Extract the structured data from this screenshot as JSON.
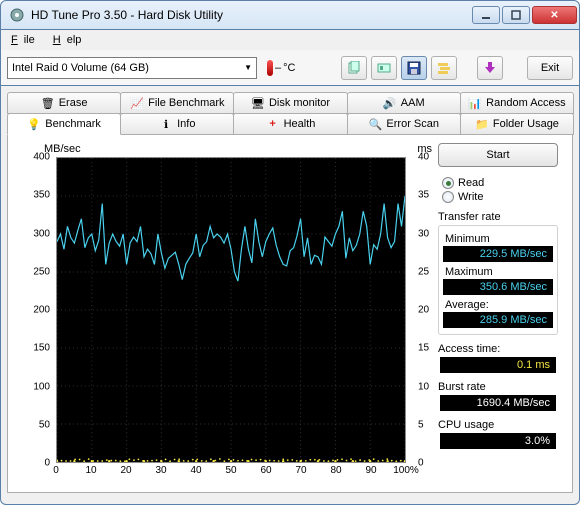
{
  "titlebar": {
    "title": "HD Tune Pro 3.50 - Hard Disk Utility"
  },
  "menu": {
    "file": "File",
    "help": "Help"
  },
  "toolbar": {
    "disk": "Intel   Raid 0 Volume (64 GB)",
    "temp": "°C",
    "exit": "Exit"
  },
  "tabs_row1": [
    "Erase",
    "File Benchmark",
    "Disk monitor",
    "AAM",
    "Random Access"
  ],
  "tabs_row2": [
    "Benchmark",
    "Info",
    "Health",
    "Error Scan",
    "Folder Usage"
  ],
  "side": {
    "start": "Start",
    "read": "Read",
    "write": "Write",
    "transfer": "Transfer rate",
    "min_l": "Minimum",
    "min_v": "229.5 MB/sec",
    "max_l": "Maximum",
    "max_v": "350.6 MB/sec",
    "avg_l": "Average:",
    "avg_v": "285.9 MB/sec",
    "access_l": "Access time:",
    "access_v": "0.1 ms",
    "burst_l": "Burst rate",
    "burst_v": "1690.4 MB/sec",
    "cpu_l": "CPU usage",
    "cpu_v": "3.0%"
  },
  "chart_data": {
    "type": "line",
    "title": "",
    "xlabel": "",
    "ylabel": "MB/sec",
    "y2label": "ms",
    "xlim": [
      0,
      100
    ],
    "ylim": [
      0,
      400
    ],
    "y2lim": [
      0,
      40
    ],
    "x_ticks": [
      "0",
      "10",
      "20",
      "30",
      "40",
      "50",
      "60",
      "70",
      "80",
      "90",
      "100%"
    ],
    "y_ticks": [
      0,
      50,
      100,
      150,
      200,
      250,
      300,
      350,
      400
    ],
    "y2_ticks": [
      0,
      5,
      10,
      15,
      20,
      25,
      30,
      35,
      40
    ],
    "series": [
      {
        "name": "Transfer rate",
        "color": "#49d1ee",
        "x": [
          0,
          1,
          2,
          3,
          4,
          5,
          6,
          7,
          8,
          9,
          10,
          11,
          12,
          13,
          14,
          15,
          16,
          17,
          18,
          19,
          20,
          21,
          22,
          23,
          24,
          25,
          26,
          27,
          28,
          29,
          30,
          31,
          32,
          33,
          34,
          35,
          36,
          37,
          38,
          39,
          40,
          41,
          42,
          43,
          44,
          45,
          46,
          47,
          48,
          49,
          50,
          51,
          52,
          53,
          54,
          55,
          56,
          57,
          58,
          59,
          60,
          61,
          62,
          63,
          64,
          65,
          66,
          67,
          68,
          69,
          70,
          71,
          72,
          73,
          74,
          75,
          76,
          77,
          78,
          79,
          80,
          81,
          82,
          83,
          84,
          85,
          86,
          87,
          88,
          89,
          90,
          91,
          92,
          93,
          94,
          95,
          96,
          97,
          98,
          99,
          100
        ],
        "values": [
          290,
          300,
          280,
          310,
          295,
          288,
          305,
          320,
          282,
          295,
          300,
          278,
          292,
          340,
          260,
          288,
          300,
          290,
          284,
          300,
          260,
          288,
          296,
          290,
          310,
          270,
          280,
          274,
          260,
          300,
          275,
          255,
          268,
          272,
          276,
          260,
          240,
          260,
          268,
          275,
          300,
          270,
          285,
          290,
          310,
          295,
          300,
          296,
          288,
          300,
          280,
          250,
          238,
          280,
          310,
          280,
          262,
          320,
          290,
          270,
          290,
          300,
          308,
          285,
          270,
          260,
          258,
          278,
          282,
          298,
          320,
          270,
          295,
          260,
          272,
          270,
          260,
          296,
          290,
          284,
          300,
          310,
          330,
          268,
          295,
          278,
          285,
          300,
          330,
          310,
          260,
          286,
          280,
          300,
          340,
          295,
          282,
          290,
          340,
          310,
          350
        ]
      },
      {
        "name": "Access time",
        "color": "#f5e642",
        "axis": "y2",
        "x": [
          0,
          5,
          10,
          15,
          20,
          25,
          30,
          35,
          40,
          45,
          50,
          55,
          60,
          65,
          70,
          75,
          80,
          85,
          90,
          95,
          100
        ],
        "values": [
          0.1,
          0.1,
          0.1,
          0.1,
          0.1,
          0.1,
          0.1,
          0.1,
          0.1,
          0.1,
          0.1,
          0.1,
          0.1,
          0.1,
          0.1,
          0.1,
          0.1,
          0.1,
          0.1,
          0.1,
          0.1
        ]
      }
    ]
  }
}
